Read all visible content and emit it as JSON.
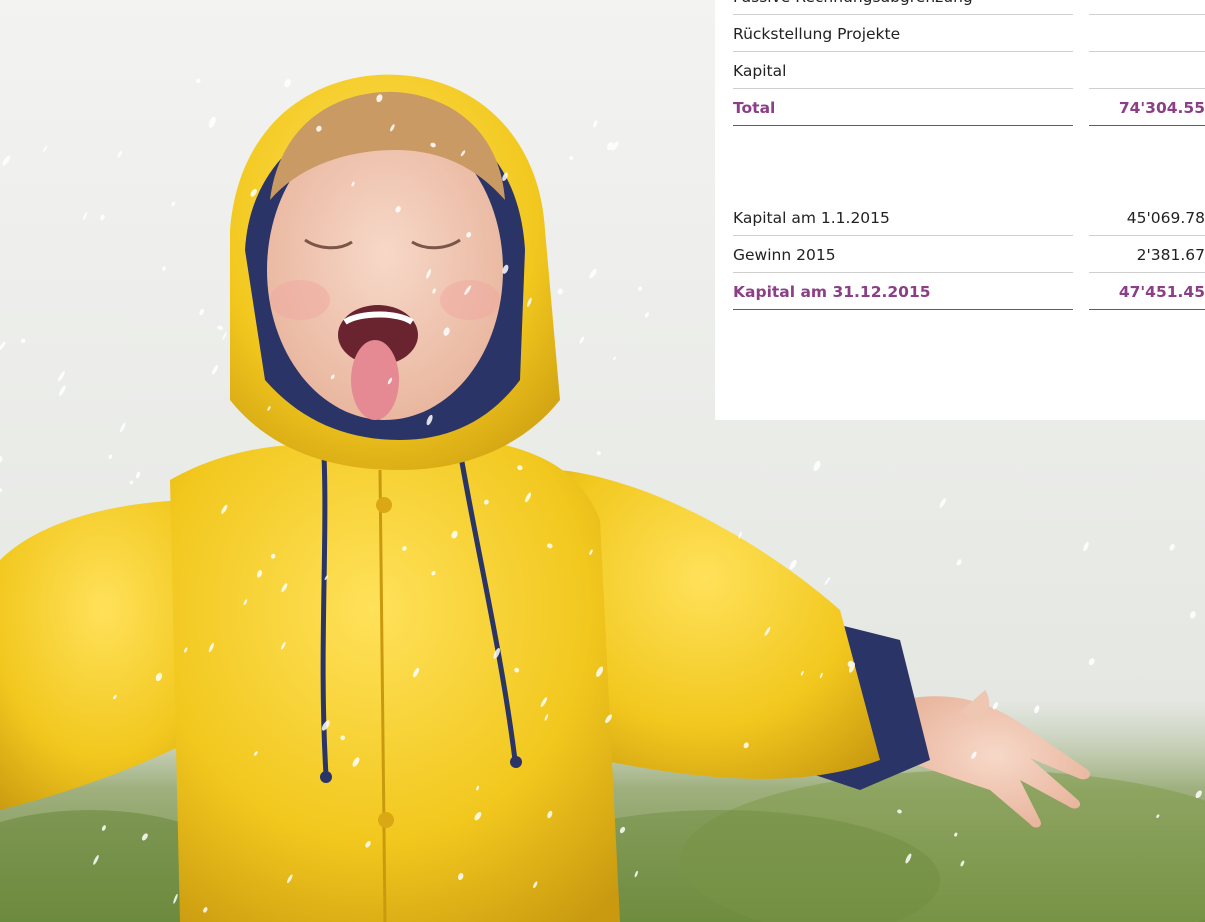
{
  "image": {
    "subject": "child-in-yellow-raincoat-in-rain"
  },
  "balance_table": {
    "rows": [
      {
        "label": "Passive Rechnungsabgrenzung",
        "value": ""
      },
      {
        "label": "Rückstellung Projekte",
        "value": ""
      },
      {
        "label": "Kapital",
        "value": ""
      }
    ],
    "total": {
      "label": "Total",
      "value": "74'304.55"
    }
  },
  "capital_table": {
    "rows": [
      {
        "label": "Kapital am 1.1.2015",
        "value": "45'069.78"
      },
      {
        "label": "Gewinn 2015",
        "value": "2'381.67"
      }
    ],
    "total": {
      "label": "Kapital am 31.12.2015",
      "value": "47'451.45"
    }
  },
  "colors": {
    "accent": "#8a3f86",
    "raincoat": "#f2c81e",
    "navy": "#2b3466",
    "rule": "#cfcfcf"
  }
}
